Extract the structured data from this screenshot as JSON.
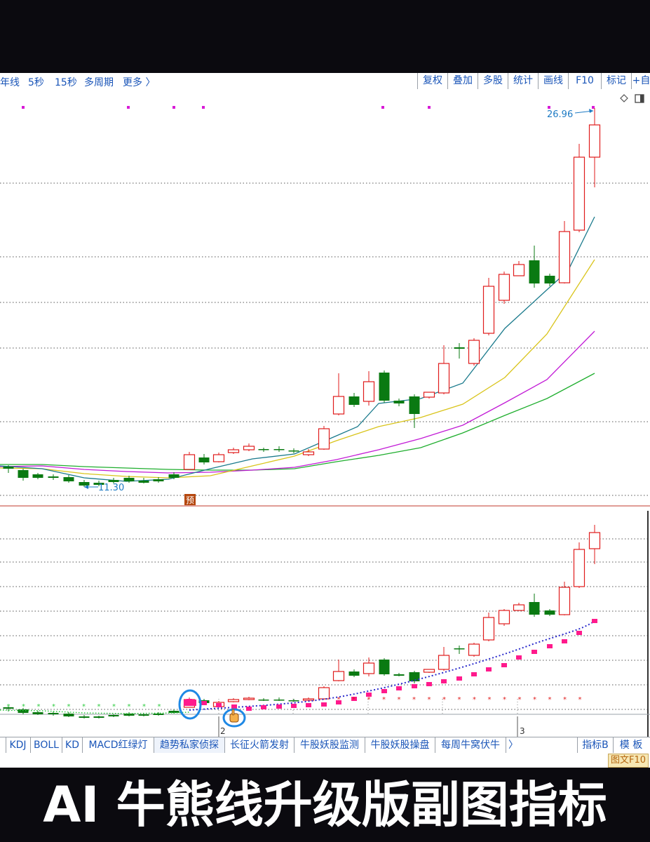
{
  "toolbar": {
    "left_items": [
      "年线",
      "5秒",
      "15秒",
      "多周期",
      "更多 〉"
    ],
    "right_items": [
      "复权",
      "叠加",
      "多股",
      "统计",
      "画线",
      "F10",
      "标记",
      "+自"
    ]
  },
  "chart": {
    "high_label": "26.96",
    "low_label": "11.30",
    "pre_marker": "预",
    "date_marks": [
      "2",
      "3"
    ],
    "colors": {
      "up": "#e01b1b",
      "down": "#0a7a12",
      "ma5": "#1a7a8c",
      "ma10": "#d9c41a",
      "ma20": "#c21bd6",
      "ma30": "#1fae2e",
      "accent": "#1e88e5",
      "dots": "#ff1a8c"
    }
  },
  "bottom_tabs": [
    "KDJ",
    "BOLL",
    "KD",
    "MACD红绿灯",
    "趋势私家侦探",
    "长征火箭发射",
    "牛股妖股监测",
    "牛股妖股操盘",
    "每周牛窝伏牛",
    "〉",
    "指标B",
    "模 板"
  ],
  "f10_label": "图文F10",
  "banner": {
    "title": "AI 牛熊线升级版副图指标"
  }
}
